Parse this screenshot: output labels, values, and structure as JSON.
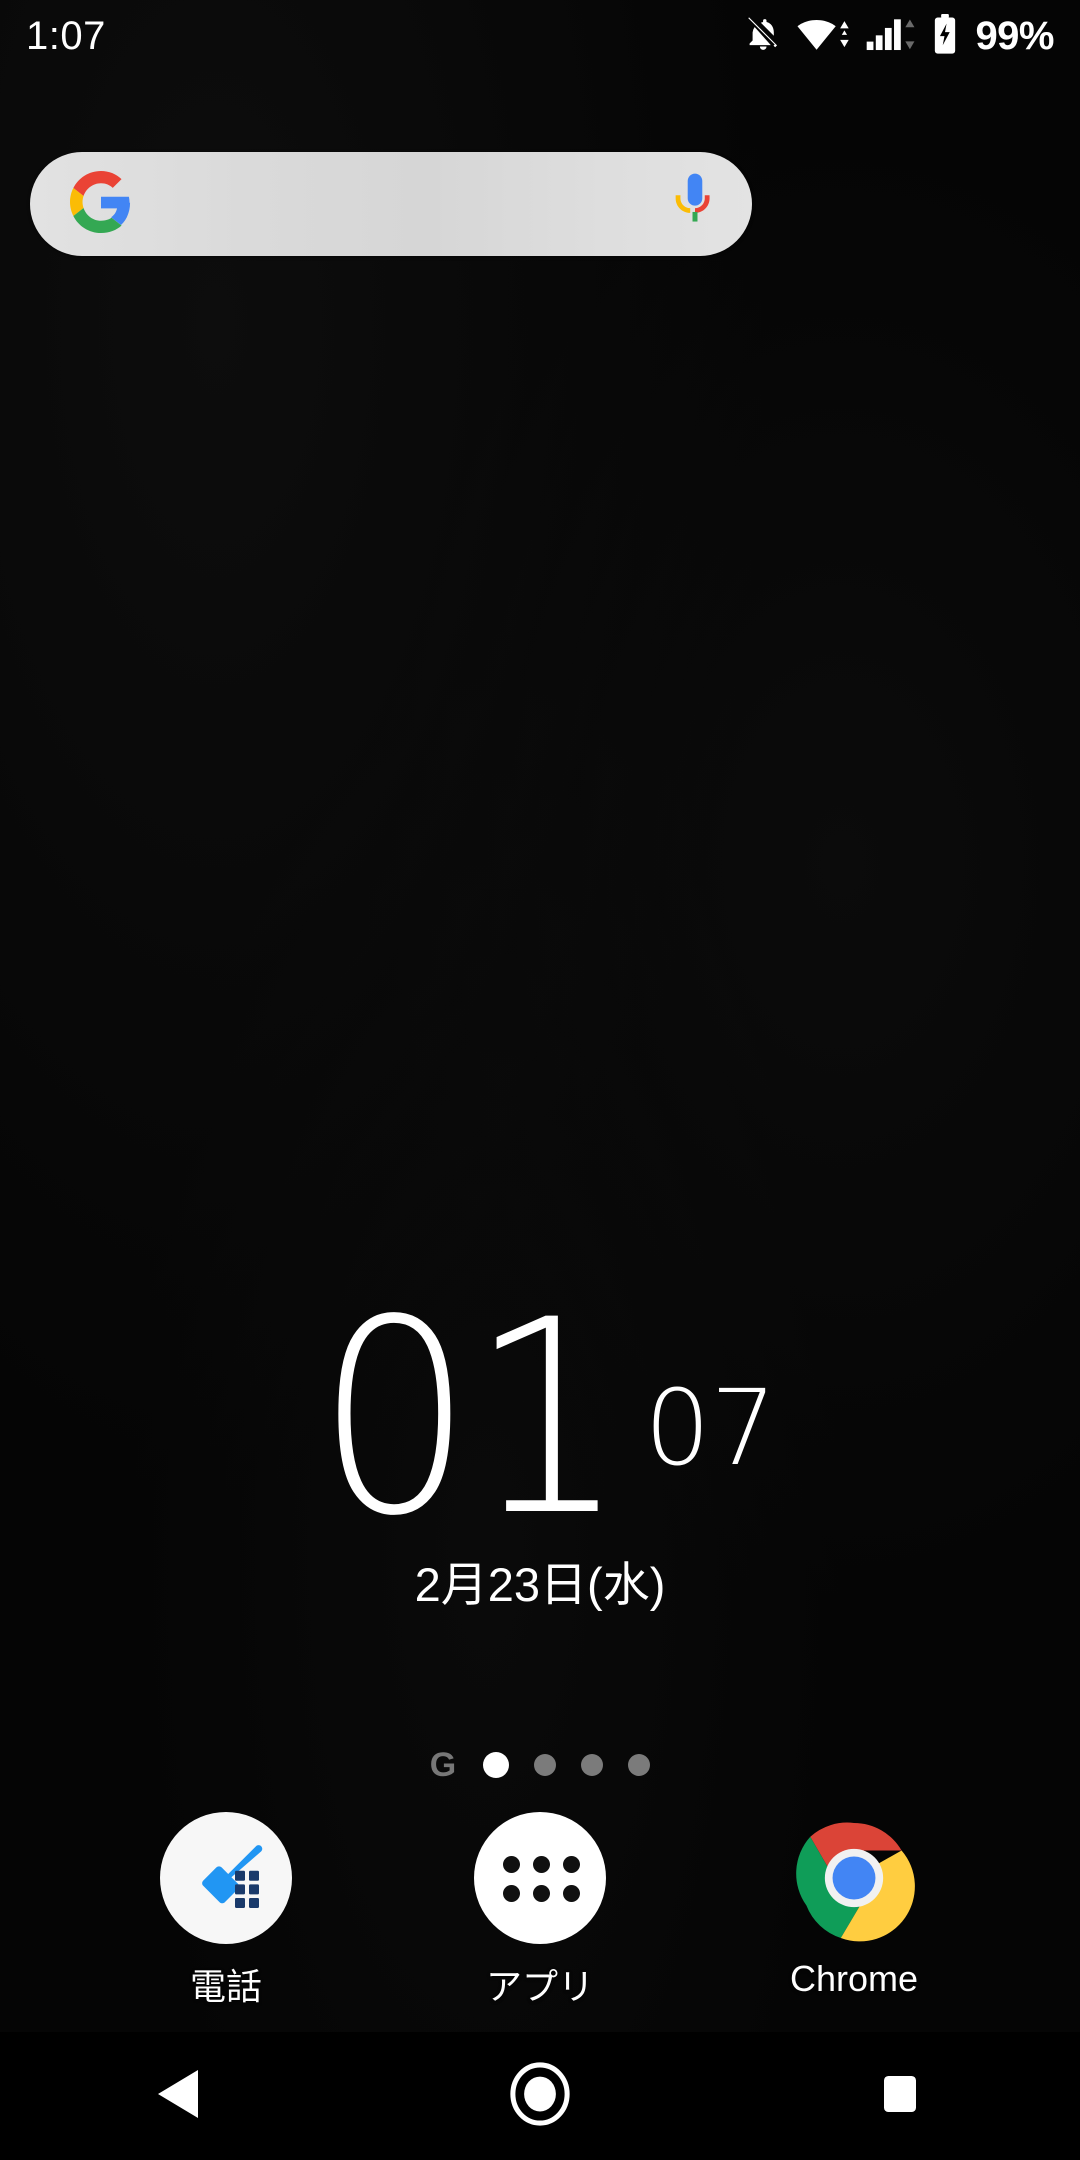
{
  "status_bar": {
    "time": "1:07",
    "battery_percent": "99%",
    "icons": [
      {
        "name": "notifications-off-icon",
        "label": "silent mode"
      },
      {
        "name": "wifi-icon",
        "label": "wifi connected with data transfer"
      },
      {
        "name": "signal-cellular-icon",
        "label": "mobile signal with data transfer"
      },
      {
        "name": "battery-charging-icon",
        "label": "battery charging"
      }
    ],
    "text_color": "#ffffff"
  },
  "search_bar": {
    "placeholder": "",
    "value": "",
    "google_logo": "google-g-logo",
    "mic": "microphone-icon",
    "background_color": "#dcdcdc"
  },
  "clock_widget": {
    "hour": "01",
    "minute": "07",
    "date": "2月23日(水)",
    "text_color": "#ffffff"
  },
  "page_indicator": {
    "google_glyph": "G",
    "pages": 4,
    "active_index": 0,
    "active_color": "#ffffff",
    "inactive_color": "#7b7b7b"
  },
  "dock": {
    "items": [
      {
        "label": "電話",
        "icon": "phone-dialer-icon",
        "bg": "#f7f7f7"
      },
      {
        "label": "アプリ",
        "icon": "app-drawer-icon",
        "bg": "#ffffff"
      },
      {
        "label": "Chrome",
        "icon": "chrome-icon",
        "bg": "#ffffff"
      }
    ]
  },
  "nav_bar": {
    "back": "back-triangle-icon",
    "home": "home-circle-icon",
    "recents": "recents-square-icon",
    "color": "#ffffff"
  },
  "wallpaper": {
    "color": "#050505"
  }
}
